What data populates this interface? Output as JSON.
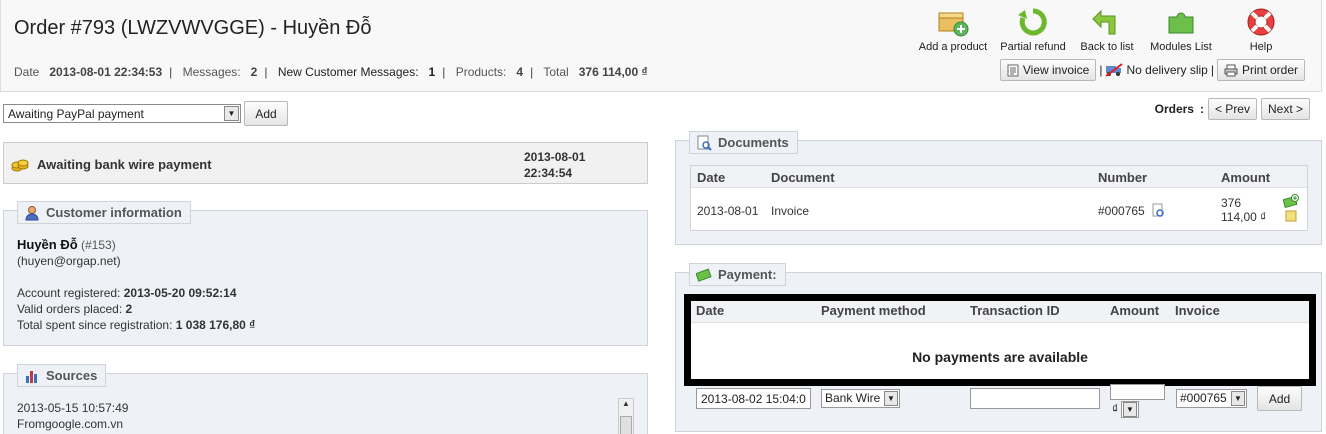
{
  "header": {
    "title": "Order #793 (LWZVWVGGE) - Huyền Đỗ",
    "toolbar": [
      {
        "label": "Add a product",
        "icon": "box-add-icon"
      },
      {
        "label": "Partial refund",
        "icon": "refund-arrow-icon"
      },
      {
        "label": "Back to list",
        "icon": "back-arrow-icon"
      },
      {
        "label": "Modules List",
        "icon": "puzzle-icon"
      },
      {
        "label": "Help",
        "icon": "lifebuoy-icon"
      }
    ]
  },
  "summary": {
    "date_label": "Date",
    "date_value": "2013-08-01 22:34:53",
    "messages_label": "Messages:",
    "messages_value": "2",
    "new_msgs_label": "New Customer Messages:",
    "new_msgs_value": "1",
    "products_label": "Products:",
    "products_value": "4",
    "total_label": "Total",
    "total_value": "376 114,00 ₫"
  },
  "doc_buttons": {
    "view_invoice": "View invoice",
    "no_delivery": "No delivery slip",
    "print_order": "Print order"
  },
  "state_form": {
    "selected": "Awaiting PayPal payment",
    "add": "Add"
  },
  "orders_nav": {
    "label": "Orders",
    "prev": "< Prev",
    "next": "Next >"
  },
  "status": {
    "text": "Awaiting bank wire payment",
    "date": "2013-08-01",
    "time": "22:34:54"
  },
  "customer": {
    "legend": "Customer information",
    "name": "Huyền Đỗ",
    "id": "(#153)",
    "email": "(huyen@orgap.net)",
    "registered_label": "Account registered:",
    "registered_value": "2013-05-20 09:52:14",
    "valid_orders_label": "Valid orders placed:",
    "valid_orders_value": "2",
    "total_spent_label": "Total spent since registration:",
    "total_spent_value": "1 038 176,80 ₫"
  },
  "sources": {
    "legend": "Sources",
    "date": "2013-05-15 10:57:49",
    "from_label": "From",
    "from_value": "google.com.vn"
  },
  "documents": {
    "legend": "Documents",
    "headers": [
      "Date",
      "Document",
      "Number",
      "Amount"
    ],
    "row": {
      "date": "2013-08-01",
      "document": "Invoice",
      "number": "#000765",
      "amount_1": "376",
      "amount_2": "114,00 ₫"
    }
  },
  "payment": {
    "legend": "Payment:",
    "headers": [
      "Date",
      "Payment method",
      "Transaction ID",
      "Amount",
      "Invoice"
    ],
    "empty": "No payments are available",
    "form": {
      "date": "2013-08-02 15:04:0",
      "method": "Bank Wire",
      "transaction": "",
      "currency": "₫",
      "invoice": "#000765",
      "add": "Add"
    }
  }
}
